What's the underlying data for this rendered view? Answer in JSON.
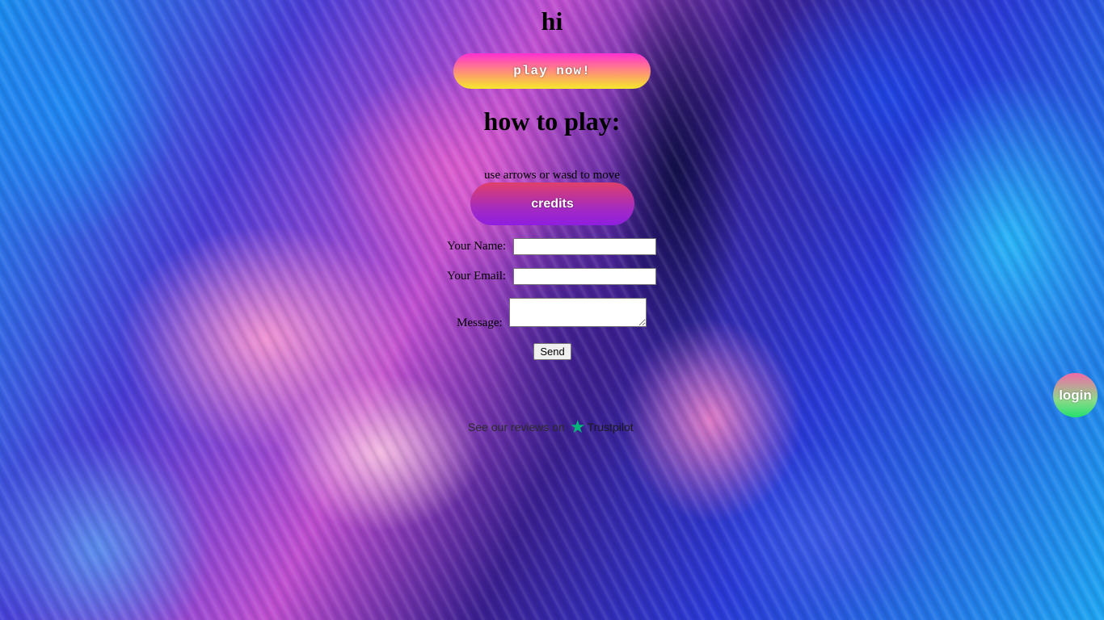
{
  "header": {
    "title": "hi"
  },
  "play": {
    "label": "play now!"
  },
  "how_to_play": {
    "heading": "how to play:",
    "instructions": "use arrows or wasd to move"
  },
  "credits": {
    "label": "credits"
  },
  "contact_form": {
    "name_label": "Your Name:",
    "name_value": "",
    "email_label": "Your Email:",
    "email_value": "",
    "message_label": "Message:",
    "message_value": "",
    "send_label": "Send"
  },
  "reviews": {
    "text": "See our reviews on",
    "brand": "Trustpilot",
    "star_icon": "star-icon",
    "star_color": "#00b67a"
  },
  "login": {
    "label": "login"
  },
  "colors": {
    "play_gradient": [
      "#ff2fd1",
      "#f6e92a"
    ],
    "credits_gradient": [
      "#e0406a",
      "#8f1ee0"
    ],
    "login_gradient": [
      "#f06aa6",
      "#24e06e"
    ]
  }
}
